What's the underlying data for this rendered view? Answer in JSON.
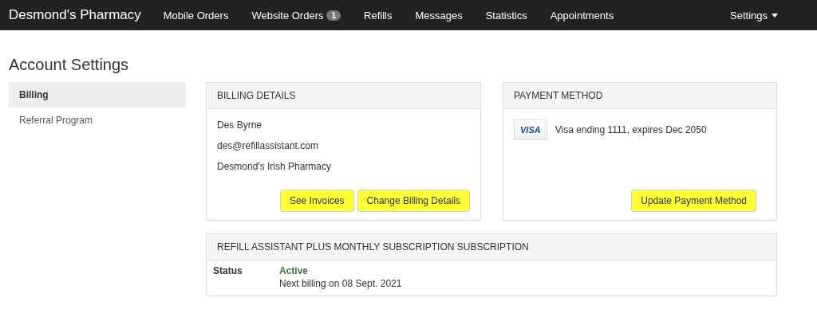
{
  "navbar": {
    "brand": "Desmond's Pharmacy",
    "items": [
      {
        "label": "Mobile Orders"
      },
      {
        "label": "Website Orders",
        "badge": "1"
      },
      {
        "label": "Refills"
      },
      {
        "label": "Messages"
      },
      {
        "label": "Statistics"
      },
      {
        "label": "Appointments"
      }
    ],
    "settings": "Settings"
  },
  "page_title": "Account Settings",
  "sidebar": {
    "items": [
      {
        "label": "Billing",
        "selected": true
      },
      {
        "label": "Referral Program",
        "selected": false
      }
    ]
  },
  "billing_details": {
    "title": "BILLING DETAILS",
    "lines": [
      "Des Byrne",
      "des@refillassistant.com",
      "Desmond's Irish Pharmacy"
    ],
    "buttons": [
      {
        "label": "See Invoices",
        "highlighted": true
      },
      {
        "label": "Change Billing Details",
        "highlighted": true
      }
    ]
  },
  "payment_method": {
    "title": "PAYMENT METHOD",
    "card_brand": "VISA",
    "card_text": "Visa ending 1111, expires Dec 2050",
    "buttons": [
      {
        "label": "Update Payment Method",
        "highlighted": true
      }
    ]
  },
  "subscription": {
    "title": "REFILL ASSISTANT PLUS MONTHLY SUBSCRIPTION SUBSCRIPTION",
    "status_label": "Status",
    "status": "Active",
    "next_billing": "Next billing on 08 Sept. 2021"
  }
}
